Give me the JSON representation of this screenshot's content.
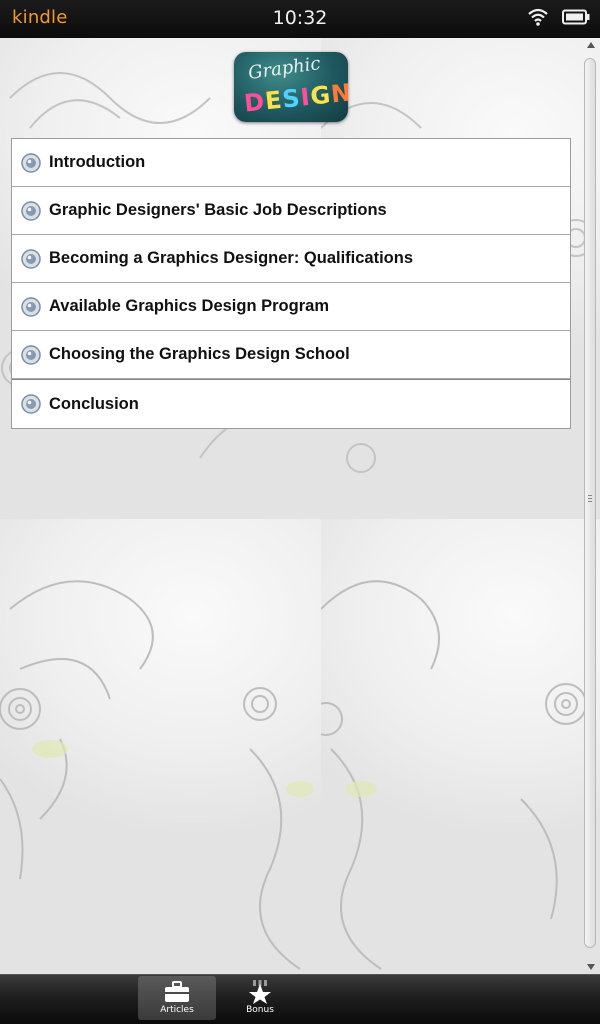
{
  "status_bar": {
    "brand": "kindle",
    "time": "10:32",
    "icons": [
      "wifi-icon",
      "battery-icon"
    ]
  },
  "logo": {
    "top_text": "Graphic",
    "bottom_letters": [
      "D",
      "E",
      "S",
      "I",
      "G",
      "N"
    ]
  },
  "menu": {
    "items": [
      {
        "label": "Introduction"
      },
      {
        "label": "Graphic Designers' Basic Job Descriptions"
      },
      {
        "label": "Becoming a Graphics Designer: Qualifications"
      },
      {
        "label": "Available Graphics Design Program"
      },
      {
        "label": "Choosing the Graphics Design School"
      },
      {
        "label": "Conclusion"
      }
    ],
    "bullet_icon": "radio-bullet-icon"
  },
  "tabs": [
    {
      "label": "Articles",
      "icon": "briefcase-icon",
      "selected": true
    },
    {
      "label": "Bonus",
      "icon": "star-icon",
      "selected": false
    }
  ],
  "colors": {
    "brand_orange": "#f39a2b",
    "tab_bar": "#1f1f1f"
  }
}
